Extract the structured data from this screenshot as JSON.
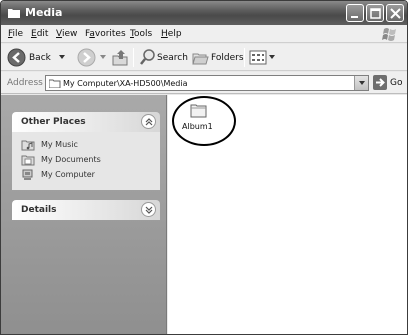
{
  "window": {
    "title": "Media"
  },
  "menu": {
    "items": [
      {
        "prefix": "",
        "accel": "F",
        "rest": "ile"
      },
      {
        "prefix": "",
        "accel": "E",
        "rest": "dit"
      },
      {
        "prefix": "",
        "accel": "V",
        "rest": "iew"
      },
      {
        "prefix": "F",
        "accel": "a",
        "rest": "vorites"
      },
      {
        "prefix": "",
        "accel": "T",
        "rest": "ools"
      },
      {
        "prefix": "",
        "accel": "H",
        "rest": "elp"
      }
    ]
  },
  "toolbar": {
    "back_label": "Back",
    "search_label": "Search",
    "folders_label": "Folders"
  },
  "address": {
    "label": "Address",
    "value": "My Computer\\XA-HD500\\Media",
    "go_label": "Go"
  },
  "other_places": {
    "title": "Other Places",
    "items": [
      {
        "label": "My Music",
        "icon": "music-folder-icon"
      },
      {
        "label": "My Documents",
        "icon": "documents-folder-icon"
      },
      {
        "label": "My Computer",
        "icon": "computer-icon"
      }
    ]
  },
  "details": {
    "title": "Details"
  },
  "content": {
    "items": [
      {
        "label": "Album1",
        "icon": "folder-icon"
      }
    ]
  }
}
